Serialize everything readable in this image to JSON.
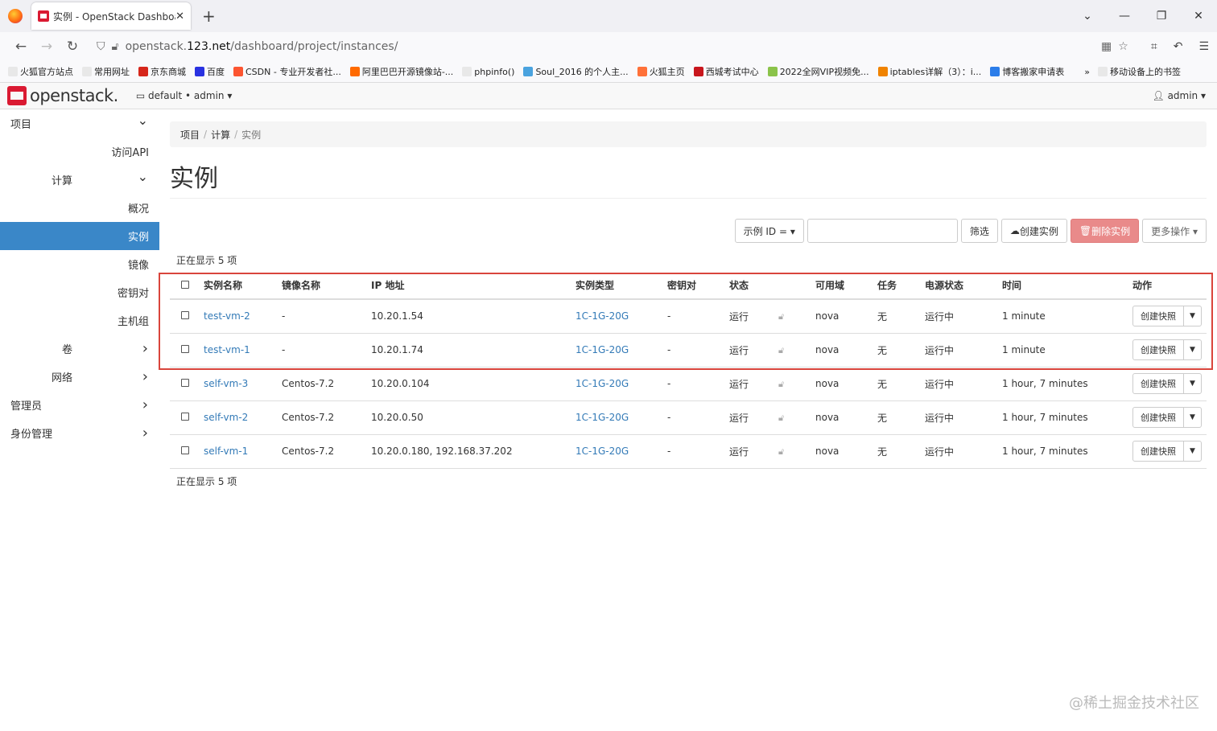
{
  "browser": {
    "tab_title": "实例 - OpenStack Dashboard",
    "url_prefix": "openstack.",
    "url_host": "123.net",
    "url_path": "/dashboard/project/instances/",
    "bookmarks": [
      {
        "label": "火狐官方站点",
        "color": "#e8e8e8"
      },
      {
        "label": "常用网址",
        "color": "#e8e8e8"
      },
      {
        "label": "京东商城",
        "color": "#d6261b"
      },
      {
        "label": "百度",
        "color": "#2932e1"
      },
      {
        "label": "CSDN - 专业开发者社...",
        "color": "#fc5531"
      },
      {
        "label": "阿里巴巴开源镜像站-...",
        "color": "#ff6a00"
      },
      {
        "label": "phpinfo()",
        "color": "#e8e8e8"
      },
      {
        "label": "Soul_2016 的个人主...",
        "color": "#4aa3df"
      },
      {
        "label": "火狐主页",
        "color": "#ff7139"
      },
      {
        "label": "西城考试中心",
        "color": "#c8161d"
      },
      {
        "label": "2022全网VIP视频免...",
        "color": "#8bc34a"
      },
      {
        "label": "iptables详解（3）：i...",
        "color": "#f08300"
      },
      {
        "label": "博客搬家申请表",
        "color": "#2b7de9"
      },
      {
        "label": "移动设备上的书签",
        "color": "#e8e8e8"
      }
    ]
  },
  "header": {
    "logo": "openstack.",
    "project": "default • admin ▾",
    "user": "admin ▾"
  },
  "sidebar": {
    "items": [
      {
        "label": "项目",
        "level": 0,
        "chev": "⌄"
      },
      {
        "label": "访问API",
        "level": 2,
        "chev": ""
      },
      {
        "label": "计算",
        "level": 1,
        "chev": "⌄"
      },
      {
        "label": "概况",
        "level": 2,
        "chev": ""
      },
      {
        "label": "实例",
        "level": 2,
        "chev": "",
        "active": true
      },
      {
        "label": "镜像",
        "level": 2,
        "chev": ""
      },
      {
        "label": "密钥对",
        "level": 2,
        "chev": ""
      },
      {
        "label": "主机组",
        "level": 2,
        "chev": ""
      },
      {
        "label": "卷",
        "level": 1,
        "chev": "›"
      },
      {
        "label": "网络",
        "level": 1,
        "chev": "›"
      },
      {
        "label": "管理员",
        "level": 0,
        "chev": "›"
      },
      {
        "label": "身份管理",
        "level": 0,
        "chev": "›"
      }
    ]
  },
  "breadcrumb": [
    "项目",
    "计算",
    "实例"
  ],
  "page_title": "实例",
  "toolbar": {
    "filter_field": "示例 ID = ▾",
    "filter_btn": "筛选",
    "create_btn": "创建实例",
    "delete_btn": "删除实例",
    "more_btn": "更多操作 ▾"
  },
  "showing_text": "正在显示 5 项",
  "table": {
    "headers": [
      "实例名称",
      "镜像名称",
      "IP 地址",
      "实例类型",
      "密钥对",
      "状态",
      "",
      "可用域",
      "任务",
      "电源状态",
      "时间",
      "动作"
    ],
    "rows": [
      {
        "name": "test-vm-2",
        "image": "-",
        "ip": "10.20.1.54",
        "flavor": "1C-1G-20G",
        "key": "-",
        "status": "运行",
        "az": "nova",
        "task": "无",
        "power": "运行中",
        "time": "1 minute",
        "action": "创建快照"
      },
      {
        "name": "test-vm-1",
        "image": "-",
        "ip": "10.20.1.74",
        "flavor": "1C-1G-20G",
        "key": "-",
        "status": "运行",
        "az": "nova",
        "task": "无",
        "power": "运行中",
        "time": "1 minute",
        "action": "创建快照"
      },
      {
        "name": "self-vm-3",
        "image": "Centos-7.2",
        "ip": "10.20.0.104",
        "flavor": "1C-1G-20G",
        "key": "-",
        "status": "运行",
        "az": "nova",
        "task": "无",
        "power": "运行中",
        "time": "1 hour, 7 minutes",
        "action": "创建快照"
      },
      {
        "name": "self-vm-2",
        "image": "Centos-7.2",
        "ip": "10.20.0.50",
        "flavor": "1C-1G-20G",
        "key": "-",
        "status": "运行",
        "az": "nova",
        "task": "无",
        "power": "运行中",
        "time": "1 hour, 7 minutes",
        "action": "创建快照"
      },
      {
        "name": "self-vm-1",
        "image": "Centos-7.2",
        "ip": "10.20.0.180, 192.168.37.202",
        "flavor": "1C-1G-20G",
        "key": "-",
        "status": "运行",
        "az": "nova",
        "task": "无",
        "power": "运行中",
        "time": "1 hour, 7 minutes",
        "action": "创建快照"
      }
    ]
  },
  "watermark": "@稀土掘金技术社区"
}
